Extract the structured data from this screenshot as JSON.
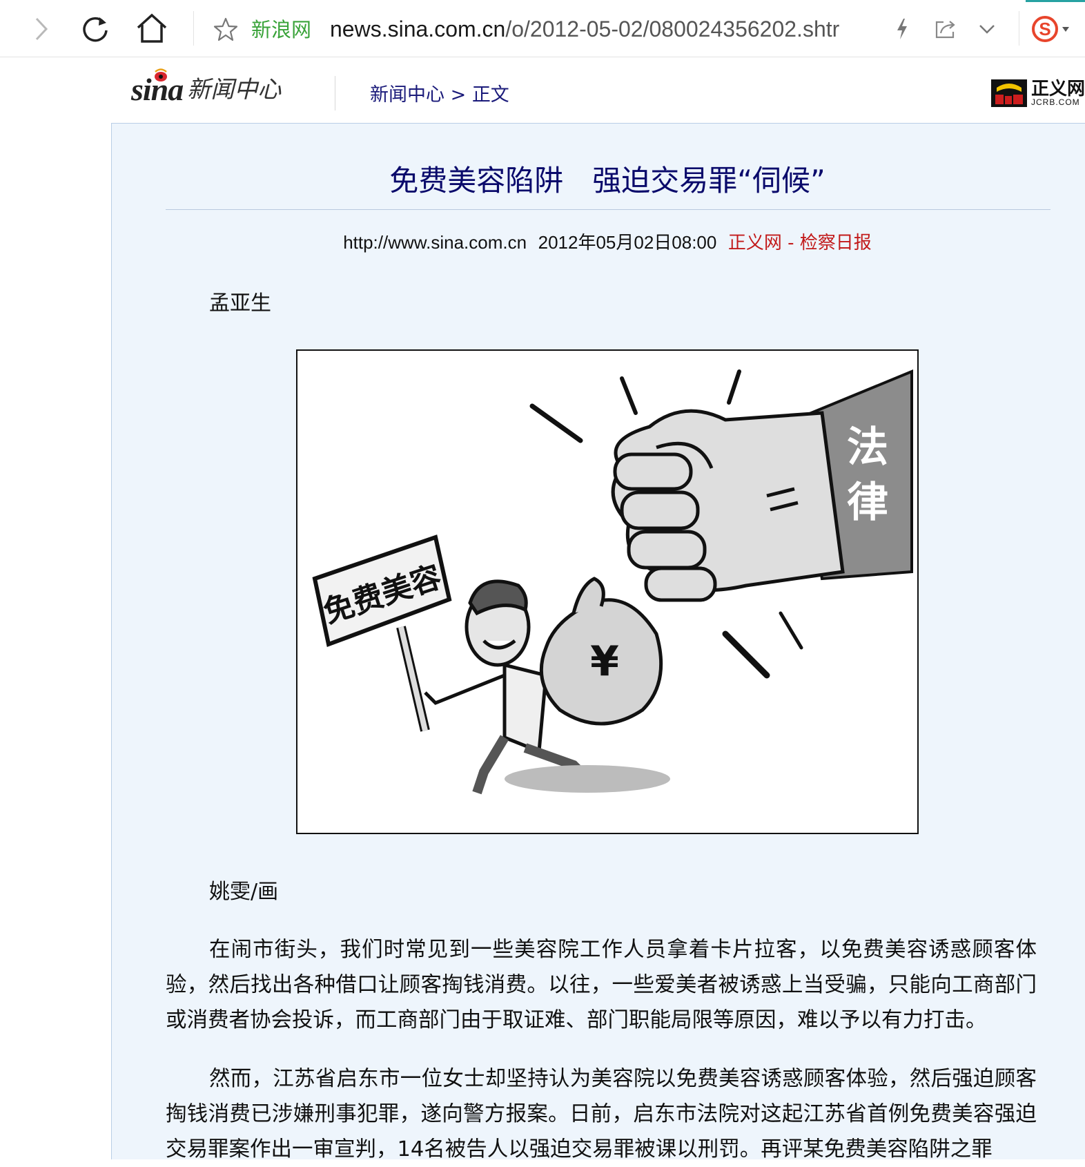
{
  "browser": {
    "site_name": "新浪网",
    "url_host": "news.sina.com.cn",
    "url_path": "/o/2012-05-02/080024356202.shtr"
  },
  "header": {
    "logo_text": "sina",
    "logo_subtitle": "新闻中心",
    "breadcrumb": {
      "home": "新闻中心",
      "separator": ">",
      "current": "正文"
    },
    "partner_logo": {
      "cn": "正义网",
      "en": "JCRB.COM"
    }
  },
  "article": {
    "title": "免费美容陷阱　强迫交易罪“伺候”",
    "meta": {
      "url": "http://www.sina.com.cn",
      "date": "2012年05月02日08:00",
      "source": "正义网 - 检察日报"
    },
    "author": "孟亚生",
    "figure": {
      "sign_text": "免费美容",
      "sleeve_text": "法律",
      "bag_symbol": "¥"
    },
    "caption": "姚雯/画",
    "paragraphs": [
      "在闹市街头，我们时常见到一些美容院工作人员拿着卡片拉客，以免费美容诱惑顾客体验，然后找出各种借口让顾客掏钱消费。以往，一些爱美者被诱惑上当受骗，只能向工商部门或消费者协会投诉，而工商部门由于取证难、部门职能局限等原因，难以予以有力打击。",
      "然而，江苏省启东市一位女士却坚持认为美容院以免费美容诱惑顾客体验，然后强迫顾客掏钱消费已涉嫌刑事犯罪，遂向警方报案。日前，启东市法院对这起江苏省首例免费美容强迫交易罪案作出一审宣判，14名被告人以强迫交易罪被课以刑罚。再评某免费美容陷阱之罪"
    ]
  },
  "colors": {
    "title": "#0a0a6b",
    "breadcrumb": "#1a1a7a",
    "source": "#c21a1a",
    "panel_bg": "#eef5fc",
    "site_name": "#3aa33a",
    "sogou_red": "#e8452c",
    "jcrb_red": "#cc1e1e"
  },
  "icons": {
    "forward": "chevron-right-icon",
    "reload": "reload-icon",
    "home": "home-icon",
    "bookmark": "star-icon",
    "lightning": "lightning-icon",
    "share": "share-icon",
    "dropdown": "chevron-down-icon",
    "sogou": "sogou-icon"
  }
}
